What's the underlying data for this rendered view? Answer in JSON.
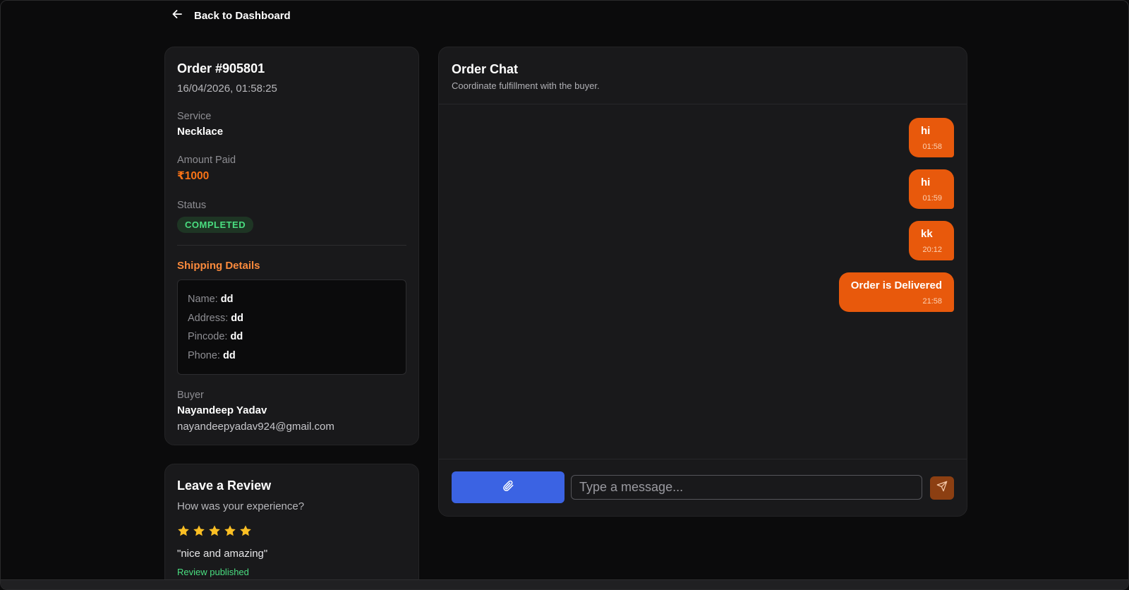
{
  "nav": {
    "back_label": "Back to Dashboard",
    "back_icon": "arrow-left-icon"
  },
  "order": {
    "title": "Order #905801",
    "date": "16/04/2026, 01:58:25",
    "service_label": "Service",
    "service_value": "Necklace",
    "amount_label": "Amount Paid",
    "amount_value": "₹1000",
    "status_label": "Status",
    "status_value": "COMPLETED",
    "shipping_title": "Shipping Details",
    "shipping": [
      {
        "key": "Name:",
        "value": "dd"
      },
      {
        "key": "Address:",
        "value": "dd"
      },
      {
        "key": "Pincode:",
        "value": "dd"
      },
      {
        "key": "Phone:",
        "value": "dd"
      }
    ],
    "buyer_label": "Buyer",
    "buyer_name": "Nayandeep Yadav",
    "buyer_email": "nayandeepyadav924@gmail.com"
  },
  "review": {
    "title": "Leave a Review",
    "question": "How was your experience?",
    "rating": 5,
    "max_rating": 5,
    "quote": "\"nice and amazing\"",
    "status": "Review published"
  },
  "chat": {
    "title": "Order Chat",
    "subtitle": "Coordinate fulfillment with the buyer.",
    "messages": [
      {
        "text": "hi",
        "time": "01:58"
      },
      {
        "text": "hi",
        "time": "01:59"
      },
      {
        "text": "kk",
        "time": "20:12"
      },
      {
        "text": "Order is Delivered",
        "time": "21:58"
      }
    ],
    "input_placeholder": "Type a message...",
    "attach_icon": "paperclip-icon",
    "send_icon": "send-icon"
  },
  "colors": {
    "accent_orange": "#e8590c",
    "attach_blue": "#3b63e3",
    "success_green": "#4ade80",
    "star_yellow": "#fbbf24"
  }
}
